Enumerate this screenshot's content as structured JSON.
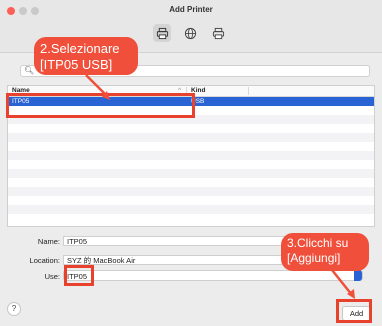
{
  "window": {
    "title": "Add Printer",
    "toolbar": [
      {
        "icon": "printer-icon"
      },
      {
        "icon": "globe-icon"
      },
      {
        "icon": "windows-printer-icon"
      }
    ]
  },
  "search": {
    "placeholder": ""
  },
  "table": {
    "columns": [
      "Name",
      "Kind"
    ],
    "sort_indicator": "^",
    "rows": [
      {
        "name": "ITP05",
        "kind": "USB",
        "selected": true
      }
    ]
  },
  "form": {
    "name_label": "Name:",
    "name_value": "ITP05",
    "location_label": "Location:",
    "location_value": "SYZ 的 MacBook Air",
    "use_label": "Use:",
    "use_value": "ITP05"
  },
  "buttons": {
    "help": "?",
    "add": "Add"
  },
  "annotations": {
    "callout_1": "2.Selezionare [ITP05 USB]",
    "callout_2": "3.Clicchi su [Aggiungi]"
  },
  "colors": {
    "selection": "#2a63d3",
    "annotation": "#e8412e",
    "callout": "#ef4f3b"
  }
}
